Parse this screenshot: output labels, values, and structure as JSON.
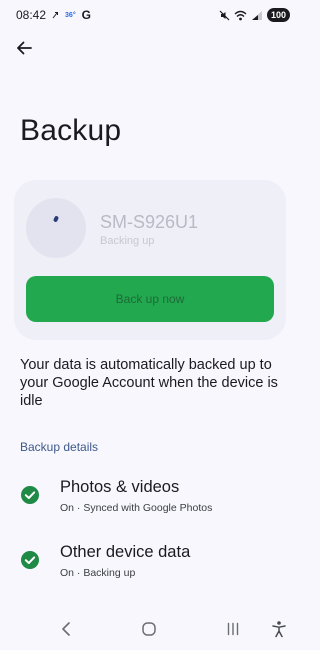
{
  "status_bar": {
    "time": "08:42",
    "temperature": "36°",
    "carrier_icon": "G",
    "battery": "100",
    "icons": [
      "mute-icon",
      "wifi-icon",
      "signal-icon",
      "battery-icon"
    ]
  },
  "header": {
    "back_icon": "back-arrow-icon",
    "title": "Backup"
  },
  "device": {
    "name": "SM-S926U1",
    "status": "Backing up",
    "button_label": "Back up now"
  },
  "info": "Your data is automatically backed up to your Google Account when the device is idle",
  "details": {
    "header": "Backup details",
    "items": [
      {
        "title": "Photos & videos",
        "subtitle": "On · Synced with Google Photos"
      },
      {
        "title": "Other device data",
        "subtitle": "On · Backing up"
      }
    ]
  },
  "colors": {
    "accent_green": "#22a84f",
    "check_green": "#1f8a46",
    "section_blue": "#3f5a8a",
    "background": "#f7f7fd"
  }
}
